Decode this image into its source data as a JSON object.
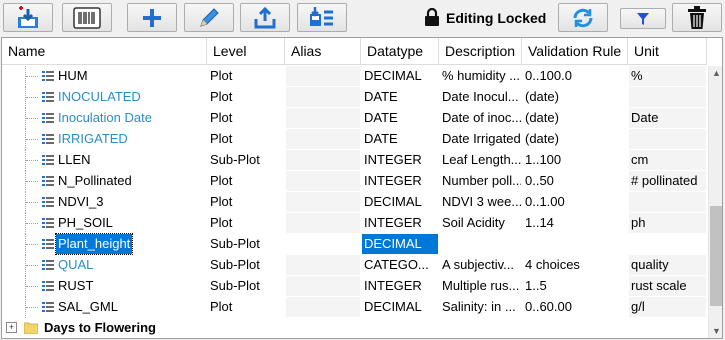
{
  "toolbar": {
    "buttons": [
      {
        "name": "import-icon"
      },
      {
        "name": "barcode-icon"
      },
      {
        "name": "plus-icon"
      },
      {
        "name": "pencil-icon"
      },
      {
        "name": "export-icon"
      },
      {
        "name": "save-tree-icon"
      }
    ],
    "lock_label": "Editing Locked",
    "refresh_icon": "refresh-icon",
    "filter_icon": "filter-icon",
    "delete_icon": "trash-icon"
  },
  "grid": {
    "columns": [
      "Name",
      "Level",
      "Alias",
      "Datatype",
      "Description",
      "Validation Rule",
      "Unit"
    ],
    "rows": [
      {
        "name": "HUM",
        "level": "Plot",
        "alias": "",
        "datatype": "DECIMAL",
        "description": "% humidity ...",
        "validation": "0..100.0",
        "unit": "%",
        "link": false
      },
      {
        "name": "INOCULATED",
        "level": "Plot",
        "alias": "",
        "datatype": "DATE",
        "description": "Date Inocul...",
        "validation": "(date)",
        "unit": "",
        "link": true
      },
      {
        "name": "Inoculation Date",
        "level": "Plot",
        "alias": "",
        "datatype": "DATE",
        "description": "Date of inoc...",
        "validation": "(date)",
        "unit": "Date",
        "link": true
      },
      {
        "name": "IRRIGATED",
        "level": "Plot",
        "alias": "",
        "datatype": "DATE",
        "description": "Date Irrigated",
        "validation": "(date)",
        "unit": "",
        "link": true
      },
      {
        "name": "LLEN",
        "level": "Sub-Plot",
        "alias": "",
        "datatype": "INTEGER",
        "description": "Leaf Length...",
        "validation": "1..100",
        "unit": "cm",
        "link": false
      },
      {
        "name": "N_Pollinated",
        "level": "Plot",
        "alias": "",
        "datatype": "INTEGER",
        "description": "Number poll...",
        "validation": "0..50",
        "unit": "# pollinated",
        "link": false
      },
      {
        "name": "NDVI_3",
        "level": "Plot",
        "alias": "",
        "datatype": "DECIMAL",
        "description": "NDVI 3 wee...",
        "validation": "0..1.00",
        "unit": "",
        "link": false
      },
      {
        "name": "PH_SOIL",
        "level": "Plot",
        "alias": "",
        "datatype": "INTEGER",
        "description": "Soil Acidity",
        "validation": "1..14",
        "unit": "ph",
        "link": false
      },
      {
        "name": "Plant_height",
        "level": "Sub-Plot",
        "alias": "",
        "datatype": "DECIMAL",
        "description": "",
        "validation": "",
        "unit": "",
        "link": false,
        "selected": true
      },
      {
        "name": "QUAL",
        "level": "Sub-Plot",
        "alias": "",
        "datatype": "CATEGO...",
        "description": "A subjectiv...",
        "validation": "4 choices",
        "unit": "quality",
        "link": true
      },
      {
        "name": "RUST",
        "level": "Sub-Plot",
        "alias": "",
        "datatype": "INTEGER",
        "description": "Multiple rus...",
        "validation": "1..5",
        "unit": "rust scale",
        "link": false
      },
      {
        "name": "SAL_GML",
        "level": "Plot",
        "alias": "",
        "datatype": "DECIMAL",
        "description": "Salinity: in ...",
        "validation": "0..60.00",
        "unit": "g/l",
        "link": false
      }
    ],
    "folder": {
      "name": "Days to Flowering",
      "expander": "+"
    }
  }
}
